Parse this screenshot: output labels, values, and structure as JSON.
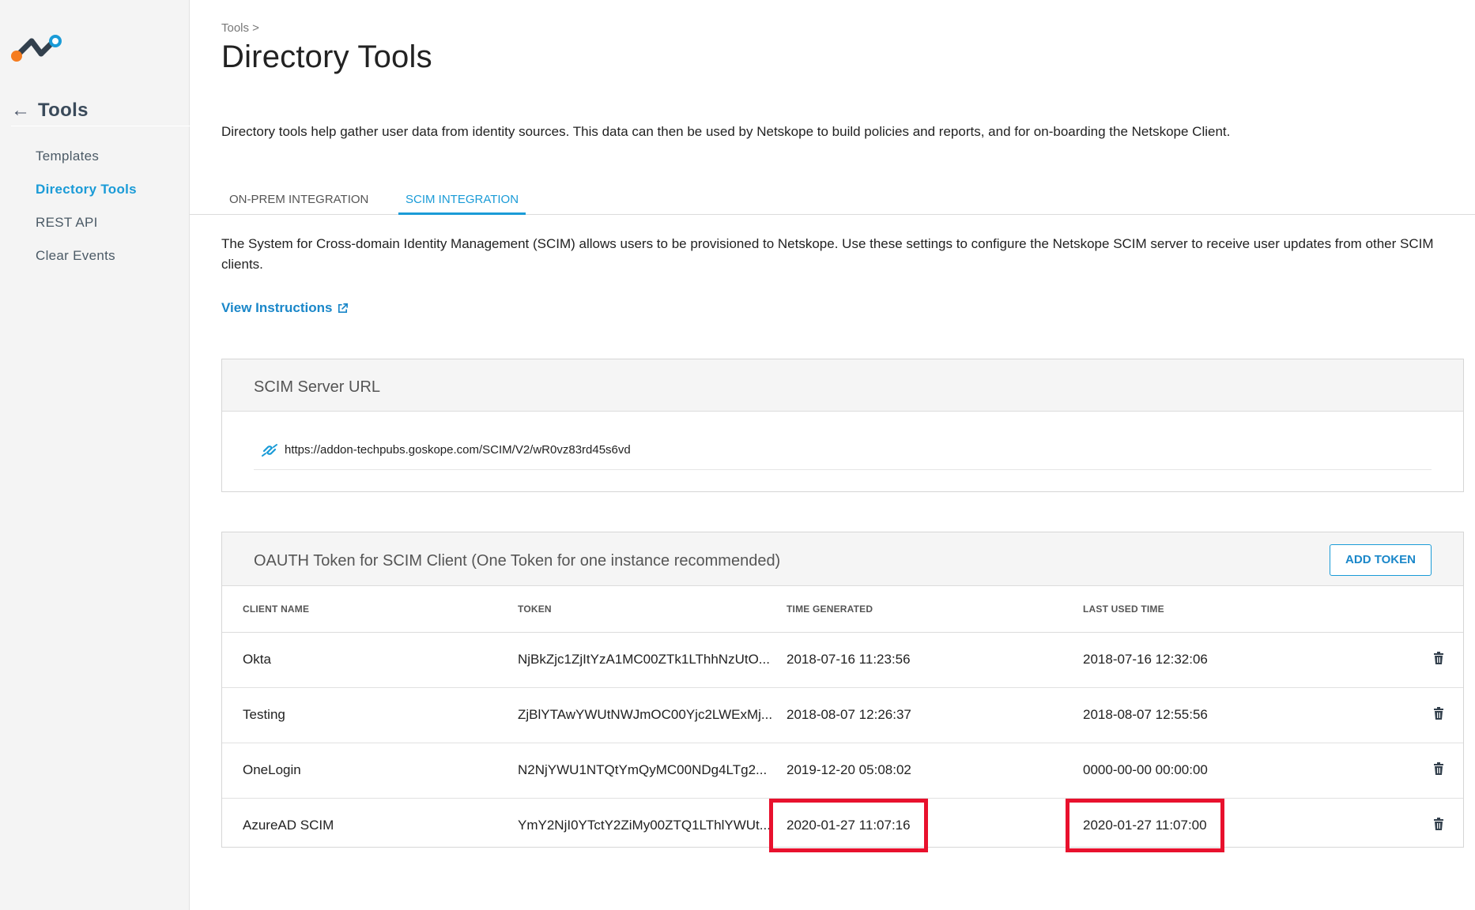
{
  "sidebar": {
    "header": "Tools",
    "items": [
      {
        "label": "Templates",
        "active": false
      },
      {
        "label": "Directory Tools",
        "active": true
      },
      {
        "label": "REST API",
        "active": false
      },
      {
        "label": "Clear Events",
        "active": false
      }
    ]
  },
  "breadcrumb": "Tools >",
  "page_title": "Directory Tools",
  "intro": "Directory tools help gather user data from identity sources. This data can then be used by Netskope to build policies and reports, and for on-boarding the Netskope Client.",
  "tabs": [
    {
      "label": "ON-PREM INTEGRATION",
      "active": false
    },
    {
      "label": "SCIM INTEGRATION",
      "active": true
    }
  ],
  "scim": {
    "description": "The System for Cross-domain Identity Management (SCIM) allows users to be provisioned to Netskope. Use these settings to configure the Netskope SCIM server to receive user updates from other SCIM clients.",
    "instructions_link": "View Instructions",
    "server_url_title": "SCIM Server URL",
    "server_url": "https://addon-techpubs.goskope.com/SCIM/V2/wR0vz83rd45s6vd"
  },
  "tokens": {
    "title": "OAUTH Token for SCIM Client (One Token for one instance recommended)",
    "add_button": "ADD TOKEN",
    "columns": [
      "CLIENT NAME",
      "TOKEN",
      "TIME GENERATED",
      "LAST USED TIME"
    ],
    "rows": [
      {
        "client": "Okta",
        "token": "NjBkZjc1ZjItYzA1MC00ZTk1LThhNzUtO...",
        "generated": "2018-07-16 11:23:56",
        "last_used": "2018-07-16 12:32:06"
      },
      {
        "client": "Testing",
        "token": "ZjBlYTAwYWUtNWJmOC00Yjc2LWExMj...",
        "generated": "2018-08-07 12:26:37",
        "last_used": "2018-08-07 12:55:56"
      },
      {
        "client": "OneLogin",
        "token": "N2NjYWU1NTQtYmQyMC00NDg4LTg2...",
        "generated": "2019-12-20 05:08:02",
        "last_used": "0000-00-00 00:00:00"
      },
      {
        "client": "AzureAD SCIM",
        "token": "YmY2NjI0YTctY2ZiMy00ZTQ1LThlYWUt...",
        "generated": "2020-01-27 11:07:16",
        "last_used": "2020-01-27 11:07:00"
      }
    ]
  },
  "colors": {
    "accent": "#1a9bd7",
    "highlight": "#e8112d",
    "logo_orange": "#f57c1f",
    "logo_dark": "#33404d",
    "logo_blue": "#1a9bd7"
  }
}
